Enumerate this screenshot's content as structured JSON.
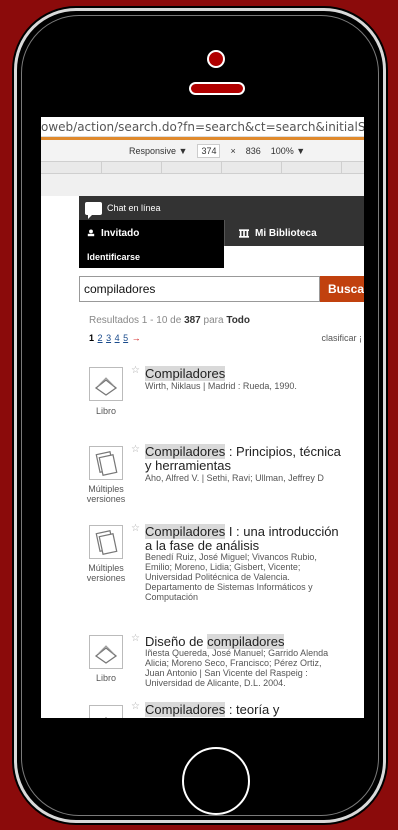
{
  "browser": {
    "url": "oweb/action/search.do?fn=search&ct=search&initialSe",
    "device": "Responsive ▼",
    "width": "374",
    "times": "×",
    "height": "836",
    "zoom": "100% ▼"
  },
  "header": {
    "chat_label": "Chat en línea",
    "user_label": "Invitado",
    "library_label": "Mi Biblioteca",
    "login_label": "Identificarse"
  },
  "search": {
    "value": "compiladores",
    "button_label": "Busca"
  },
  "results_info": {
    "prefix": "Resultados 1 - 10 de",
    "total": "387",
    "scope_prefix": "para",
    "scope": "Todo"
  },
  "pager": {
    "pages": [
      "1",
      "2",
      "3",
      "4",
      "5"
    ],
    "next": "→",
    "sort_label": "clasificar ¡"
  },
  "results": [
    {
      "format": "Libro",
      "title_hl": "Compiladores",
      "title_rest": "",
      "title_line2": "",
      "details": [
        "Wirth, Niklaus | Madrid : Rueda, 1990."
      ]
    },
    {
      "format": "Múltiples versiones",
      "title_hl": "Compiladores",
      "title_rest": " : Principios, técnica",
      "title_line2": "y herramientas",
      "details": [
        "Aho, Alfred V. | Sethi, Ravi; Ullman, Jeffrey D"
      ]
    },
    {
      "format": "Múltiples versiones",
      "title_hl": "Compiladores",
      "title_rest": " I : una introducción",
      "title_line2": "a la fase de análisis",
      "details": [
        "Benedí Ruiz, José Miguel; Vivancos Rubio,",
        "Emilio; Moreno, Lidia; Gisbert, Vicente;",
        "Universidad Politécnica de Valencia.",
        "Departamento de Sistemas Informáticos y",
        "Computación"
      ]
    },
    {
      "format": "Libro",
      "title_pre": "Diseño de ",
      "title_hl": "compiladores",
      "title_rest": "",
      "title_line2": "",
      "details": [
        "Iñesta Quereda, José Manuel; Garrido Alenda",
        "Alicia; Moreno Seco, Francisco; Pérez Ortiz,",
        "Juan Antonio | San Vicente del Raspeig :",
        "Universidad de Alicante, D.L. 2004."
      ]
    },
    {
      "format": "",
      "title_hl": "Compiladores",
      "title_rest": " : teoría y",
      "title_line2": "",
      "details": []
    }
  ]
}
